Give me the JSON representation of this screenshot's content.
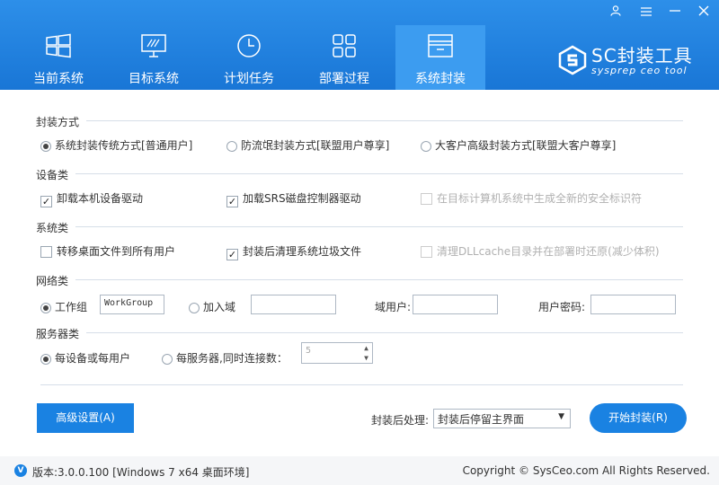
{
  "nav": [
    {
      "label": "当前系统",
      "icon": "windows-icon"
    },
    {
      "label": "目标系统",
      "icon": "monitor-icon"
    },
    {
      "label": "计划任务",
      "icon": "clock-icon"
    },
    {
      "label": "部署过程",
      "icon": "grid-icon"
    },
    {
      "label": "系统封装",
      "icon": "package-icon"
    }
  ],
  "brand": {
    "title": "SC封装工具",
    "subtitle": "sysprep ceo tool"
  },
  "sections": {
    "method": {
      "title": "封装方式",
      "options": [
        "系统封装传统方式[普通用户]",
        "防流氓封装方式[联盟用户尊享]",
        "大客户高级封装方式[联盟大客户尊享]"
      ]
    },
    "device": {
      "title": "设备类",
      "options": [
        "卸载本机设备驱动",
        "加载SRS磁盘控制器驱动",
        "在目标计算机系统中生成全新的安全标识符"
      ]
    },
    "system": {
      "title": "系统类",
      "options": [
        "转移桌面文件到所有用户",
        "封装后清理系统垃圾文件",
        "清理DLLcache目录并在部署时还原(减少体积)"
      ]
    },
    "network": {
      "title": "网络类",
      "workgroup_label": "工作组",
      "workgroup_value": "WorkGroup",
      "domain_label": "加入域",
      "domain_user_label": "域用户:",
      "password_label": "用户密码:"
    },
    "server": {
      "title": "服务器类",
      "per_device_label": "每设备或每用户",
      "per_server_label": "每服务器,同时连接数：",
      "connections": "5"
    }
  },
  "actions": {
    "advanced": "高级设置(A)",
    "post_label": "封装后处理:",
    "post_value": "封装后停留主界面",
    "start": "开始封装(R)"
  },
  "footer": {
    "version": "版本:3.0.0.100 [Windows 7 x64 桌面环境]",
    "copyright": "Copyright © SysCeo.com All Rights Reserved."
  }
}
